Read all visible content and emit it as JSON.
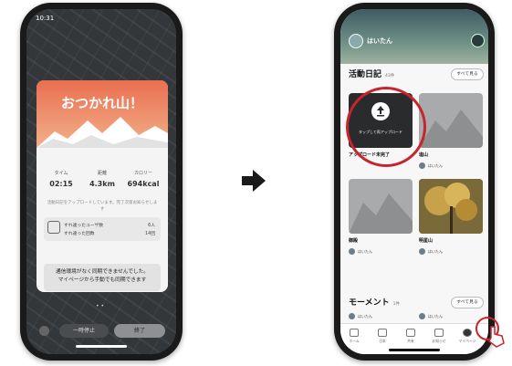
{
  "left_phone": {
    "status_time": "10:31",
    "finish_title": "おつかれ山！",
    "stats": [
      {
        "label": "タイム",
        "value": "02:15"
      },
      {
        "label": "距離",
        "value": "4.3km"
      },
      {
        "label": "カロリー",
        "value": "694kcal"
      }
    ],
    "note": "活動日記をアップロードしています。完了次第お知らせします",
    "passed_label_1": "すれ違ったユーザ数",
    "passed_count_1": "6人",
    "passed_label_2": "すれ違った回数",
    "passed_count_2": "14回",
    "toast_line1": "通信環境がなく同期できませんでした。",
    "toast_line2": "マイページから手動でも同期できます",
    "pager": "• •",
    "later_button": "一時停止",
    "done_button": "終了"
  },
  "arrow": "next-arrow",
  "right_phone": {
    "username": "はいたん",
    "diary_title": "活動日記",
    "diary_count": "43件",
    "see_all": "すべて見る",
    "upload_text": "タップして再アップロード",
    "tiles": [
      {
        "title": "アップロード未完了",
        "meta": "",
        "user": ""
      },
      {
        "title": "塩山",
        "meta": "",
        "user": "はいたん"
      },
      {
        "title": "御殿",
        "meta": "",
        "user": "はいたん"
      },
      {
        "title": "明星山",
        "meta": "",
        "user": "はいたん"
      }
    ],
    "moment_title": "モーメント",
    "moment_count": "1件",
    "moment_users": [
      "はいたん",
      "はいたん"
    ],
    "tabs": [
      "ホーム",
      "日本",
      "共有",
      "お知らせ",
      "マイページ"
    ]
  },
  "colors": {
    "accent_red": "#c8242d",
    "sunset_top": "#e96f50"
  }
}
